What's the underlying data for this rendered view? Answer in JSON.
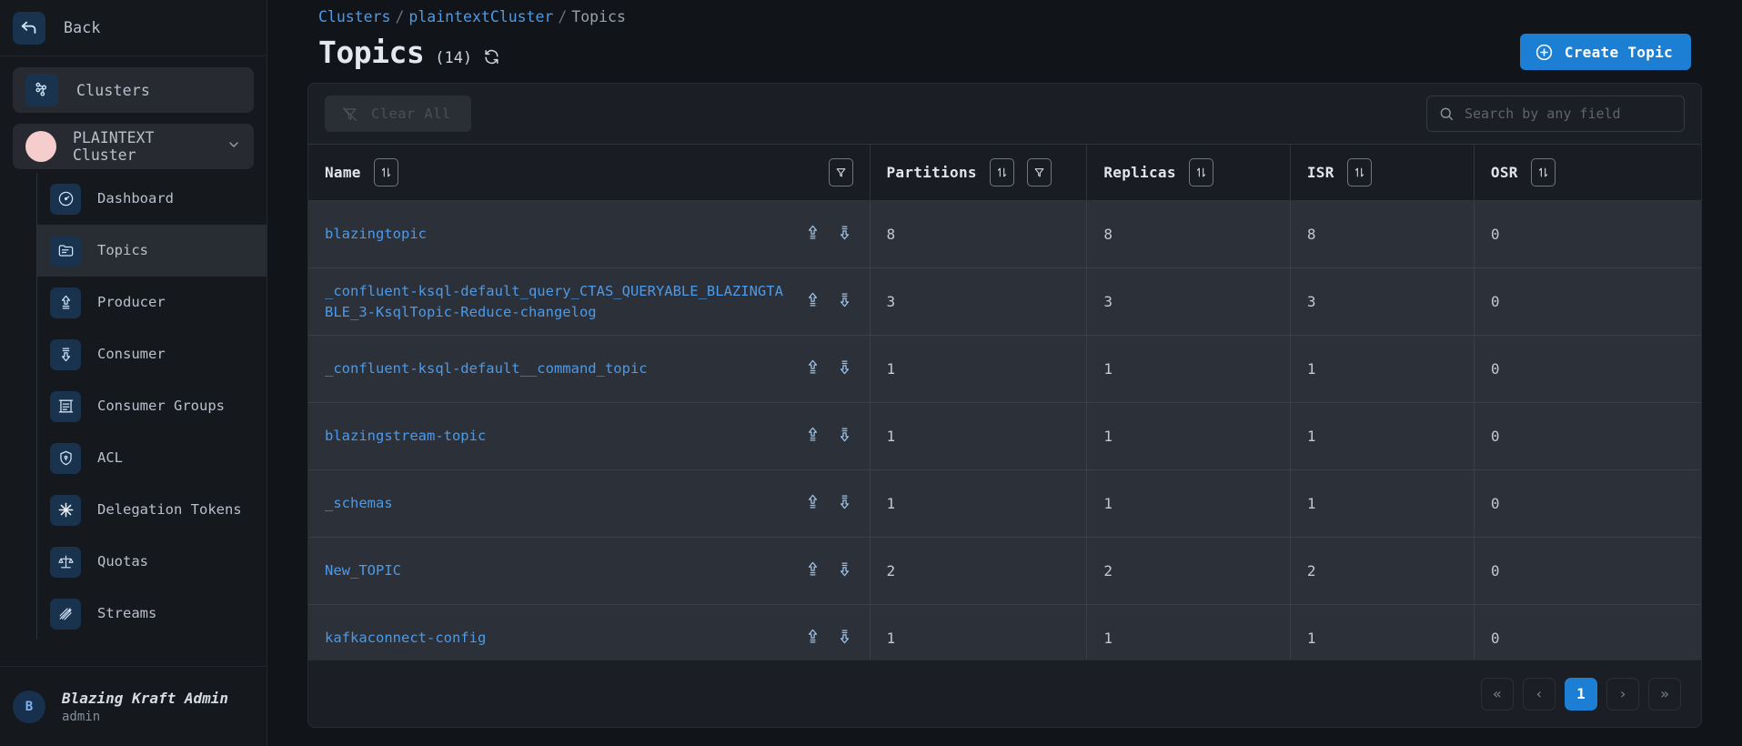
{
  "sidebar": {
    "back_label": "Back",
    "clusters_label": "Clusters",
    "selected_cluster": "PLAINTEXT Cluster",
    "nav": [
      {
        "label": "Dashboard",
        "icon": "gauge-icon",
        "active": false
      },
      {
        "label": "Topics",
        "icon": "folder-icon",
        "active": true
      },
      {
        "label": "Producer",
        "icon": "upload-arrow-icon",
        "active": false
      },
      {
        "label": "Consumer",
        "icon": "download-arrow-icon",
        "active": false
      },
      {
        "label": "Consumer Groups",
        "icon": "list-box-icon",
        "active": false
      },
      {
        "label": "ACL",
        "icon": "shield-lock-icon",
        "active": false
      },
      {
        "label": "Delegation Tokens",
        "icon": "snowflake-icon",
        "active": false
      },
      {
        "label": "Quotas",
        "icon": "scales-icon",
        "active": false
      },
      {
        "label": "Streams",
        "icon": "streams-icon",
        "active": false
      }
    ],
    "user": {
      "initial": "B",
      "name": "Blazing Kraft Admin",
      "role": "admin"
    }
  },
  "header": {
    "breadcrumb": {
      "root": "Clusters",
      "cluster": "plaintextCluster",
      "current": "Topics",
      "separator": "/"
    },
    "title": "Topics",
    "count": "(14)",
    "refresh_icon": "refresh-icon",
    "create_button": "Create Topic",
    "create_icon": "plus-circle-icon"
  },
  "toolbar": {
    "clear_all_label": "Clear All",
    "clear_all_icon": "filter-off-icon",
    "search_placeholder": "Search by any field",
    "search_value": "",
    "search_icon": "search-icon"
  },
  "table": {
    "columns": [
      {
        "label": "Name",
        "sortable": true,
        "filterable": true
      },
      {
        "label": "Partitions",
        "sortable": true,
        "filterable": true
      },
      {
        "label": "Replicas",
        "sortable": true,
        "filterable": false
      },
      {
        "label": "ISR",
        "sortable": true,
        "filterable": false
      },
      {
        "label": "OSR",
        "sortable": true,
        "filterable": false
      }
    ],
    "sort_icon": "sort-updown-icon",
    "filter_icon": "funnel-icon",
    "row_actions": [
      "produce-icon",
      "consume-icon"
    ],
    "rows": [
      {
        "name": "blazingtopic",
        "partitions": "8",
        "replicas": "8",
        "isr": "8",
        "osr": "0"
      },
      {
        "name": "_confluent-ksql-default_query_CTAS_QUERYABLE_BLAZINGTABLE_3-KsqlTopic-Reduce-changelog",
        "partitions": "3",
        "replicas": "3",
        "isr": "3",
        "osr": "0"
      },
      {
        "name": "_confluent-ksql-default__command_topic",
        "partitions": "1",
        "replicas": "1",
        "isr": "1",
        "osr": "0"
      },
      {
        "name": "blazingstream-topic",
        "partitions": "1",
        "replicas": "1",
        "isr": "1",
        "osr": "0"
      },
      {
        "name": "_schemas",
        "partitions": "1",
        "replicas": "1",
        "isr": "1",
        "osr": "0"
      },
      {
        "name": "New_TOPIC",
        "partitions": "2",
        "replicas": "2",
        "isr": "2",
        "osr": "0"
      },
      {
        "name": "kafkaconnect-config",
        "partitions": "1",
        "replicas": "1",
        "isr": "1",
        "osr": "0"
      }
    ]
  },
  "pagination": {
    "first": "«",
    "prev": "‹",
    "current_page": "1",
    "next": "›",
    "last": "»"
  },
  "colors": {
    "accent": "#1d7fd4",
    "link": "#4d9ae8",
    "page_bg": "#111418",
    "sidebar_bg": "#15191e",
    "panel_bg": "#1b1f25",
    "row_bg": "#2b3039",
    "cluster_dot": "#f6cdcd"
  }
}
